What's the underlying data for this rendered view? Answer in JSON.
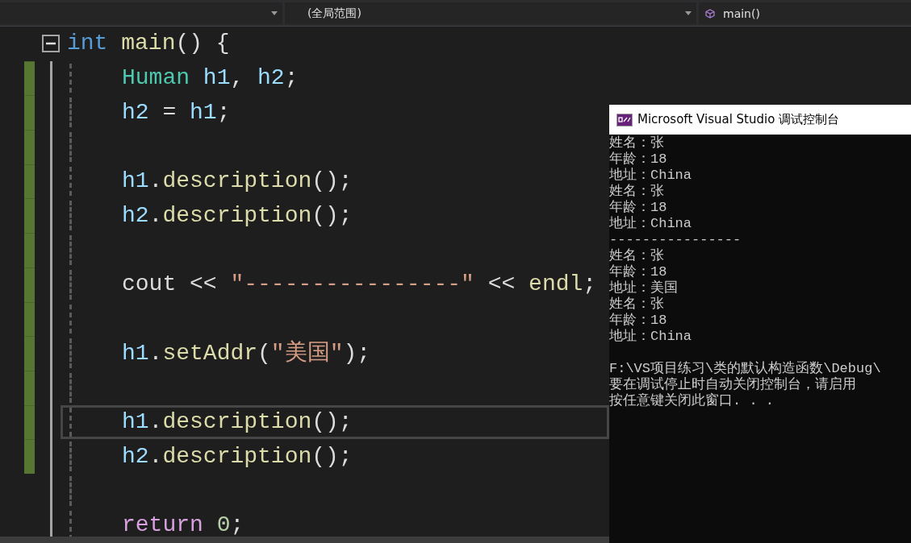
{
  "nav_bar": {
    "dropdowns": [
      {
        "kind": "project"
      },
      {
        "kind": "scope",
        "label": "(全局范围)"
      },
      {
        "kind": "member",
        "label": "main()"
      }
    ]
  },
  "editor": {
    "lines": [
      {
        "tokens": [
          {
            "text": "int ",
            "kind": "keyword"
          },
          {
            "text": "main",
            "kind": "func"
          },
          {
            "text": "() {",
            "kind": "plain"
          }
        ],
        "expanded": true,
        "changed": false,
        "current": false,
        "children": [
          {
            "tokens": [
              {
                "text": "Human ",
                "kind": "type"
              },
              {
                "text": "h1",
                "kind": "var"
              },
              {
                "text": ", ",
                "kind": "plain"
              },
              {
                "text": "h2",
                "kind": "var"
              },
              {
                "text": ";",
                "kind": "plain"
              }
            ],
            "changed": true,
            "current": false
          },
          {
            "tokens": [
              {
                "text": "h2",
                "kind": "var"
              },
              {
                "text": " = ",
                "kind": "plain"
              },
              {
                "text": "h1",
                "kind": "var"
              },
              {
                "text": ";",
                "kind": "plain"
              }
            ],
            "changed": true,
            "current": false
          },
          {
            "changed": true,
            "current": false
          },
          {
            "tokens": [
              {
                "text": "h1",
                "kind": "var"
              },
              {
                "text": ".",
                "kind": "plain"
              },
              {
                "text": "description",
                "kind": "func"
              },
              {
                "text": "();",
                "kind": "plain"
              }
            ],
            "changed": true,
            "current": false
          },
          {
            "tokens": [
              {
                "text": "h2",
                "kind": "var"
              },
              {
                "text": ".",
                "kind": "plain"
              },
              {
                "text": "description",
                "kind": "func"
              },
              {
                "text": "();",
                "kind": "plain"
              }
            ],
            "changed": true,
            "current": false
          },
          {
            "changed": true,
            "current": false
          },
          {
            "tokens": [
              {
                "text": "cout << ",
                "kind": "plain"
              },
              {
                "text": "\"----------------\"",
                "kind": "string"
              },
              {
                "text": " << ",
                "kind": "plain"
              },
              {
                "text": "endl",
                "kind": "func"
              },
              {
                "text": ";",
                "kind": "plain"
              }
            ],
            "changed": true,
            "current": false
          },
          {
            "changed": true,
            "current": false
          },
          {
            "tokens": [
              {
                "text": "h1",
                "kind": "var"
              },
              {
                "text": ".",
                "kind": "plain"
              },
              {
                "text": "setAddr",
                "kind": "func"
              },
              {
                "text": "(",
                "kind": "plain"
              },
              {
                "text": "\"美国\"",
                "kind": "string"
              },
              {
                "text": ");",
                "kind": "plain"
              }
            ],
            "changed": true,
            "current": false
          },
          {
            "changed": true,
            "current": false
          },
          {
            "tokens": [
              {
                "text": "h1",
                "kind": "var"
              },
              {
                "text": ".",
                "kind": "plain"
              },
              {
                "text": "description",
                "kind": "func"
              },
              {
                "text": "();",
                "kind": "plain"
              }
            ],
            "changed": true,
            "current": true
          },
          {
            "tokens": [
              {
                "text": "h2",
                "kind": "var"
              },
              {
                "text": ".",
                "kind": "plain"
              },
              {
                "text": "description",
                "kind": "func"
              },
              {
                "text": "();",
                "kind": "plain"
              }
            ],
            "changed": true,
            "current": false
          },
          {
            "changed": false,
            "current": false
          },
          {
            "tokens": [
              {
                "text": "return ",
                "kind": "control"
              },
              {
                "text": "0",
                "kind": "number"
              },
              {
                "text": ";",
                "kind": "plain"
              }
            ],
            "changed": false,
            "current": false
          }
        ]
      }
    ]
  },
  "console": {
    "title": "Microsoft Visual Studio 调试控制台",
    "blocks": [
      [
        "姓名：张",
        "年龄：18",
        "地址：China",
        "姓名：张",
        "年龄：18",
        "地址：China",
        "----------------",
        "姓名：张",
        "年龄：18",
        "地址：美国",
        "姓名：张",
        "年龄：18",
        "地址：China"
      ],
      [
        "F:\\VS项目练习\\类的默认构造函数\\Debug\\",
        "要在调试停止时自动关闭控制台，请启用",
        "按任意键关闭此窗口. . ."
      ]
    ]
  }
}
